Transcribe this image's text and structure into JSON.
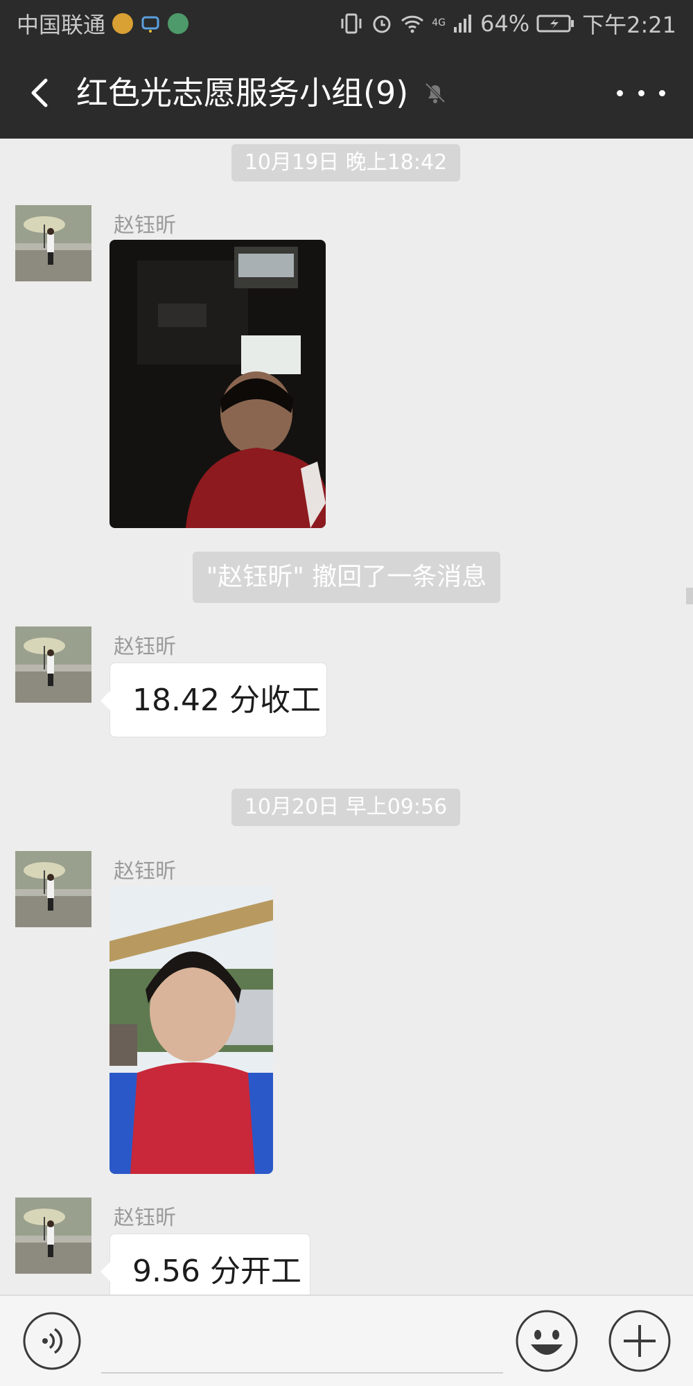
{
  "status_bar": {
    "carrier": "中国联通",
    "network": "4G",
    "battery": "64%",
    "time": "下午2:21",
    "icons": [
      "mail-notification-icon",
      "chat-notification-icon",
      "app-notification-icon",
      "vibrate-icon",
      "alarm-icon",
      "wifi-icon",
      "signal-icon",
      "battery-icon"
    ]
  },
  "nav": {
    "title": "红色光志愿服务小组(9)",
    "back_icon": "chevron-left-icon",
    "mute_icon": "bell-muted-icon",
    "more_icon": "more-dots-icon"
  },
  "messages": {
    "time1": "10月19日 晚上18:42",
    "sender1": "赵钰昕",
    "recall_notice": "\"赵钰昕\" 撤回了一条消息",
    "sender2": "赵钰昕",
    "text2": "18.42 分收工",
    "time2": "10月20日 早上09:56",
    "sender3": "赵钰昕",
    "sender4": "赵钰昕",
    "text4": "9.56 分开工"
  },
  "input_bar": {
    "placeholder": "",
    "voice_icon": "voice-input-icon",
    "emoji_icon": "emoji-icon",
    "plus_icon": "plus-icon"
  },
  "colors": {
    "header_bg": "#2b2b2b",
    "chat_bg": "#ededed",
    "pill_bg": "#d6d6d6",
    "bubble_bg": "#ffffff"
  }
}
